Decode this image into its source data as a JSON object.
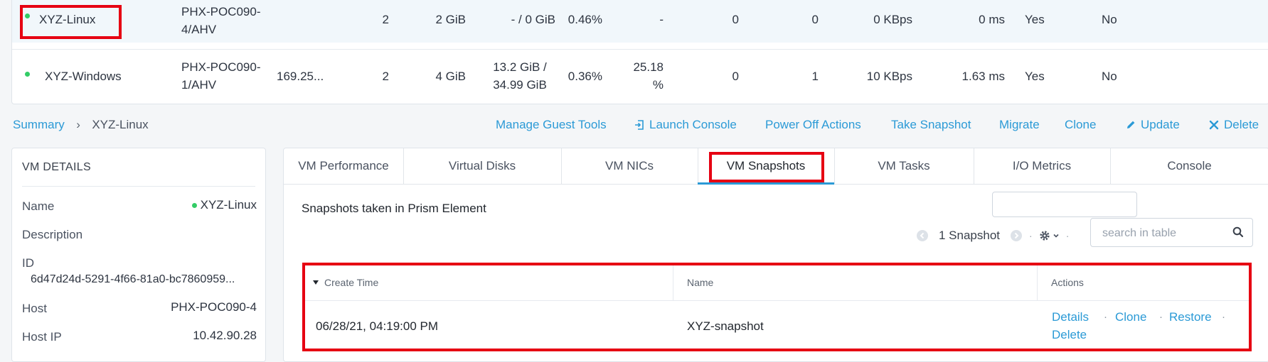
{
  "vm_table": {
    "rows": [
      {
        "name": "XYZ-Linux",
        "host_line1": "PHX-POC090-",
        "host_line2": "4/AHV",
        "ip": "",
        "cores": "2",
        "memory": "2 GiB",
        "storage_line1": "- / 0 GiB",
        "storage_line2": "",
        "cpu_usage": "0.46%",
        "memory_usage_line1": "-",
        "memory_usage_line2": "",
        "read_iops": "0",
        "write_iops": "0",
        "io_bandwidth": "0 KBps",
        "io_latency": "0 ms",
        "flash_mode": "Yes",
        "ha": "No"
      },
      {
        "name": "XYZ-Windows",
        "host_line1": "PHX-POC090-",
        "host_line2": "1/AHV",
        "ip": "169.25...",
        "cores": "2",
        "memory": "4 GiB",
        "storage_line1": "13.2 GiB /",
        "storage_line2": "34.99 GiB",
        "cpu_usage": "0.36%",
        "memory_usage_line1": "25.18",
        "memory_usage_line2": "%",
        "read_iops": "0",
        "write_iops": "1",
        "io_bandwidth": "10 KBps",
        "io_latency": "1.63 ms",
        "flash_mode": "Yes",
        "ha": "No"
      }
    ],
    "status_color": "#33cc66"
  },
  "breadcrumb": {
    "root": "Summary",
    "separator": "›",
    "current": "XYZ-Linux"
  },
  "actions": {
    "manage_guest_tools": "Manage Guest Tools",
    "launch_console": "Launch Console",
    "power_off": "Power Off Actions",
    "take_snapshot": "Take Snapshot",
    "migrate": "Migrate",
    "clone": "Clone",
    "update": "Update",
    "delete": "Delete"
  },
  "vm_details": {
    "title": "VM DETAILS",
    "name_label": "Name",
    "name_value": "XYZ-Linux",
    "description_label": "Description",
    "id_label": "ID",
    "id_value": "6d47d24d-5291-4f66-81a0-bc7860959...",
    "host_label": "Host",
    "host_value": "PHX-POC090-4",
    "host_ip_label": "Host IP",
    "host_ip_value": "10.42.90.28"
  },
  "tabs": [
    {
      "label": "VM Performance"
    },
    {
      "label": "Virtual Disks"
    },
    {
      "label": "VM NICs"
    },
    {
      "label": "VM Snapshots"
    },
    {
      "label": "VM Tasks"
    },
    {
      "label": "I/O Metrics"
    },
    {
      "label": "Console"
    }
  ],
  "active_tab": "VM Snapshots",
  "snapshots": {
    "section_title": "Snapshots taken in Prism Element",
    "count_label": "1 Snapshot",
    "search_placeholder": "search in table",
    "columns": {
      "create_time": "Create Time",
      "name": "Name",
      "actions": "Actions"
    },
    "rows": [
      {
        "create_time": "06/28/21, 04:19:00 PM",
        "name": "XYZ-snapshot",
        "actions": [
          "Details",
          "Clone",
          "Restore",
          "Delete"
        ]
      }
    ]
  },
  "colors": {
    "accent": "#2b9ad6",
    "highlight": "#e60012",
    "status_on": "#33cc66"
  }
}
